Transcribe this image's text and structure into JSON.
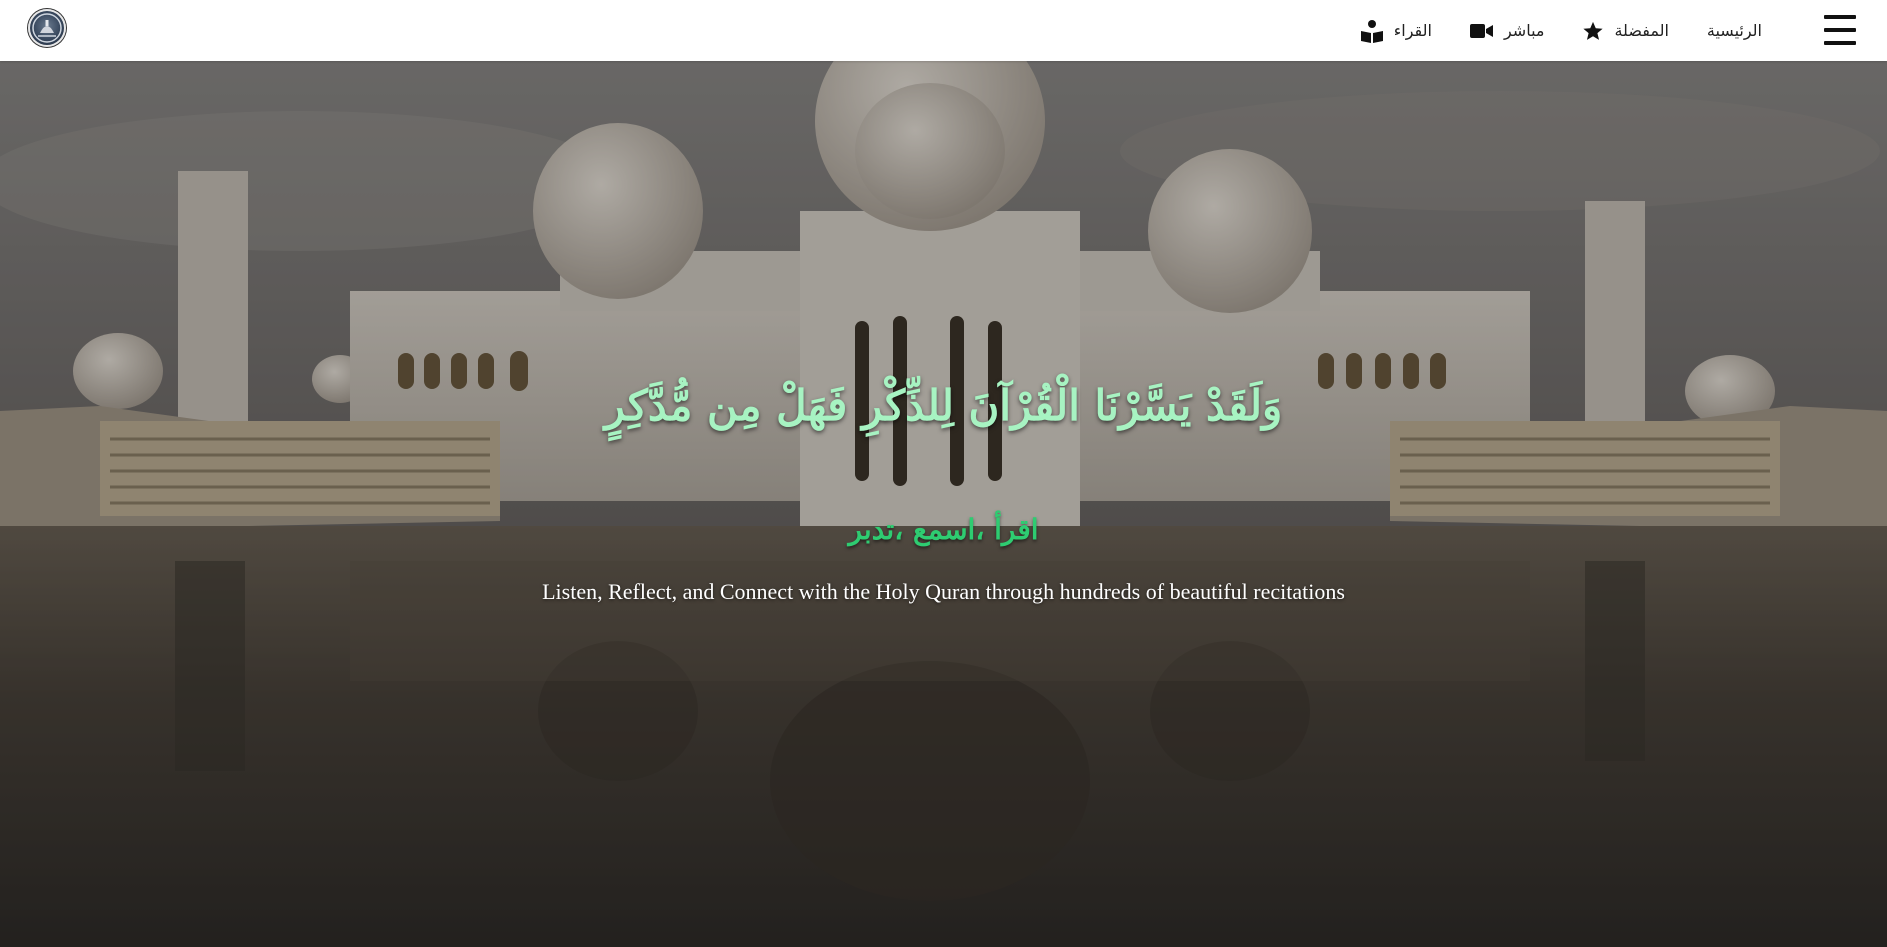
{
  "nav": {
    "menu_icon": "hamburger-menu-icon",
    "logo_icon": "site-logo-icon",
    "items": [
      {
        "label": "الرئيسية",
        "icon": ""
      },
      {
        "label": "المفضلة",
        "icon": "star-icon"
      },
      {
        "label": "مباشر",
        "icon": "video-camera-icon"
      },
      {
        "label": "القراء",
        "icon": "reader-icon"
      }
    ]
  },
  "hero": {
    "verse": "وَلَقَدْ يَسَّرْنَا الْقُرْآنَ لِلذِّكْرِ فَهَلْ مِن مُّدَّكِرٍ",
    "tagline": "اقرأ ،اسمع ،تدبر",
    "subtitle": "Listen, Reflect, and Connect with the Holy Quran through hundreds of beautiful recitations",
    "background": "mosque-photo",
    "colors": {
      "verse": "#a7f3c2",
      "tagline": "#2ecc71",
      "subtitle": "#ffffff"
    }
  }
}
